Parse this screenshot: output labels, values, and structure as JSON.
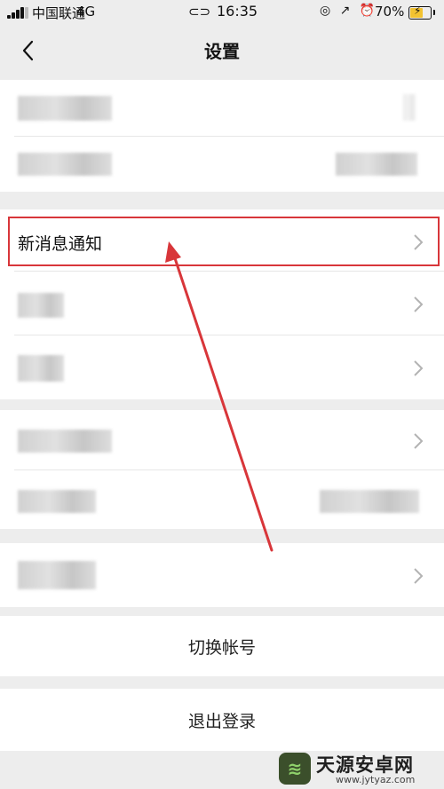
{
  "status_bar": {
    "carrier": "中国联通",
    "network": "4G",
    "link_icon": "link-icon",
    "time": "16:35",
    "right_icons": "◎ ↗ ⏰",
    "battery_percent": "70%",
    "battery_level": 0.7,
    "battery_color": "#f2c230"
  },
  "nav": {
    "back_icon": "chevron-left-icon",
    "title": "设置"
  },
  "settings": {
    "notification_label": "新消息通知",
    "switch_account": "切换帐号",
    "logout": "退出登录"
  },
  "annotation": {
    "highlight_color": "#d8363a",
    "arrow_color": "#d8363a"
  },
  "watermark": {
    "title": "天源安卓网",
    "url": "www.jytyaz.com"
  }
}
